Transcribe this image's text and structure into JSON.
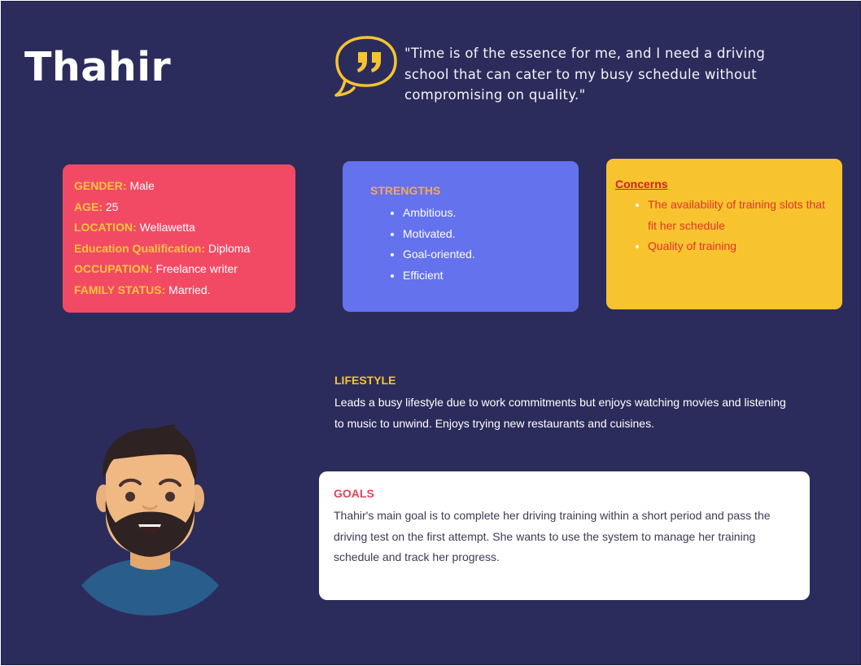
{
  "persona": {
    "name": "Thahir",
    "quote": "\"Time is of the essence for me, and I need a driving school that can cater to my busy schedule without compromising on quality.\""
  },
  "info": [
    {
      "label": "GENDER:",
      "value": " Male"
    },
    {
      "label": "AGE:",
      "value": " 25"
    },
    {
      "label": "LOCATION:",
      "value": " Wellawetta"
    },
    {
      "label": "Education Qualification:",
      "value": " Diploma"
    },
    {
      "label": "OCCUPATION:",
      "value": " Freelance writer"
    },
    {
      "label": "FAMILY STATUS:",
      "value": " Married."
    }
  ],
  "strengths": {
    "heading": "STRENGTHS",
    "items": [
      "Ambitious.",
      "Motivated.",
      "Goal-oriented.",
      "Efficient"
    ]
  },
  "concerns": {
    "heading": "Concerns",
    "items": [
      "The availability of training slots that fit her schedule",
      "Quality of training"
    ]
  },
  "lifestyle": {
    "heading": "LIFESTYLE",
    "text": "Leads a busy lifestyle due to work commitments but enjoys watching movies and listening to music to unwind. Enjoys trying new restaurants and cuisines."
  },
  "goals": {
    "heading": "GOALS",
    "text": " Thahir's main goal is to complete her driving training within a short period and pass the driving test on the first attempt. She wants to use the system to manage her training schedule and track her progress."
  },
  "icons": {
    "quote": "speech-bubble-quote-icon",
    "avatar": "bearded-man-avatar"
  },
  "colors": {
    "background": "#2c2c5c",
    "info_card": "#f24a64",
    "strengths_card": "#6472ee",
    "concerns_card": "#f7c42f",
    "accent_yellow": "#fcc53c",
    "goals_card": "#ffffff"
  }
}
